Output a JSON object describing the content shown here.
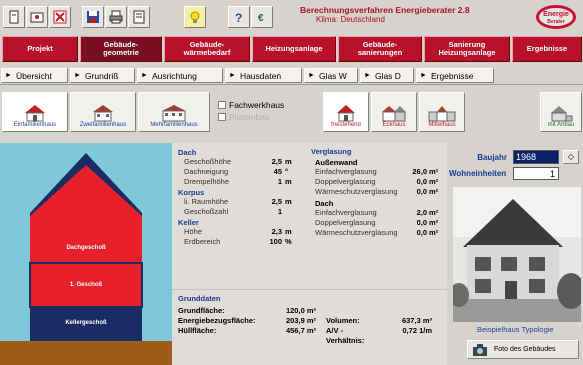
{
  "header": {
    "title": "Berechnungsverfahren Energieberater 2.8",
    "climate": "Klima: Deutschland",
    "logo_text": "Energie Berater"
  },
  "toolbar": {
    "icons": [
      "new-document-icon",
      "open-icon",
      "delete-icon",
      "save-icon",
      "print-icon",
      "print-preview-icon",
      "lightbulb-icon",
      "help-icon",
      "euro-icon"
    ]
  },
  "main_tabs": [
    {
      "label": "Projekt"
    },
    {
      "label": "Gebäude-\ngeometrie"
    },
    {
      "label": "Gebäude-\nwärmebedarf"
    },
    {
      "label": "Heizungsanlage"
    },
    {
      "label": "Gebäude-\nsanierungen"
    },
    {
      "label": "Sanierung\nHeizungsanlage"
    },
    {
      "label": "Ergebnisse"
    }
  ],
  "sub_tabs": [
    {
      "label": "Übersicht"
    },
    {
      "label": "Grundriß"
    },
    {
      "label": "Ausrichtung"
    },
    {
      "label": "Hausdaten"
    },
    {
      "label": "Glas W"
    },
    {
      "label": "Glas D"
    },
    {
      "label": "Ergebnisse"
    }
  ],
  "types": {
    "house_types": [
      {
        "label": "Einfamilienhaus"
      },
      {
        "label": "Zweifamilienhaus"
      },
      {
        "label": "Mehrfamilienhaus"
      }
    ],
    "fachwerk": "Fachwerkhaus",
    "plattenbau": "Plattenbau",
    "positions": [
      {
        "label": "freistehend"
      },
      {
        "label": "Eckhaus"
      },
      {
        "label": "Mittelhaus"
      }
    ],
    "extra": "mit Anbau"
  },
  "house_diagram": {
    "floors": [
      "Dachgeschoß",
      "1. Geschoß",
      "Kellergeschoß"
    ]
  },
  "params": {
    "dach": {
      "title": "Dach",
      "rows": [
        {
          "k": "Geschoßhöhe",
          "v": "2,5",
          "u": "m"
        },
        {
          "k": "Dachneigung",
          "v": "45",
          "u": "°"
        },
        {
          "k": "Drempelhöhe",
          "v": "1",
          "u": "m"
        }
      ]
    },
    "korpus": {
      "title": "Korpus",
      "rows": [
        {
          "k": "li. Raumhöhe",
          "v": "2,5",
          "u": "m"
        },
        {
          "k": "Geschoßzahl",
          "v": "1",
          "u": ""
        }
      ]
    },
    "keller": {
      "title": "Keller",
      "rows": [
        {
          "k": "Höhe",
          "v": "2,3",
          "u": "m"
        },
        {
          "k": "Erdbereich",
          "v": "100",
          "u": "%"
        }
      ]
    }
  },
  "glazing": {
    "title": "Verglasung",
    "aussenwand": {
      "title": "Außenwand",
      "rows": [
        {
          "k": "Einfachverglasung",
          "v": "26,0",
          "u": "m²"
        },
        {
          "k": "Doppelverglasung",
          "v": "0,0",
          "u": "m²"
        },
        {
          "k": "Wärmeschutzverglasung",
          "v": "0,0",
          "u": "m²"
        }
      ]
    },
    "dach": {
      "title": "Dach",
      "rows": [
        {
          "k": "Einfachverglasung",
          "v": "2,0",
          "u": "m²"
        },
        {
          "k": "Doppelverglasung",
          "v": "0,0",
          "u": "m²"
        },
        {
          "k": "Wärmeschutzverglasung",
          "v": "0,0",
          "u": "m²"
        }
      ]
    }
  },
  "basics": {
    "title": "Grunddaten",
    "grundflaeche_label": "Grundfläche:",
    "grundflaeche": "120,0 m²",
    "energie_label": "Energiebezugsfläche:",
    "energie": "203,9 m²",
    "volumen_label": "Volumen:",
    "volumen": "637,3 m³",
    "huell_label": "Hüllfläche:",
    "huell": "456,7 m²",
    "av_label": "A/V - Verhältnis:",
    "av": "0,72 1/m"
  },
  "right": {
    "baujahr_label": "Baujahr",
    "baujahr": "1968",
    "we_label": "Wohneinheiten",
    "we": "1",
    "photo_caption": "Beispielhaus Typologie",
    "photo_button": "Foto des Gebäudes"
  },
  "colors": {
    "accent_red": "#b8122b",
    "title_blue": "#1a3a90",
    "roof_navy": "#1a2c64",
    "floor_red": "#e8202a"
  }
}
